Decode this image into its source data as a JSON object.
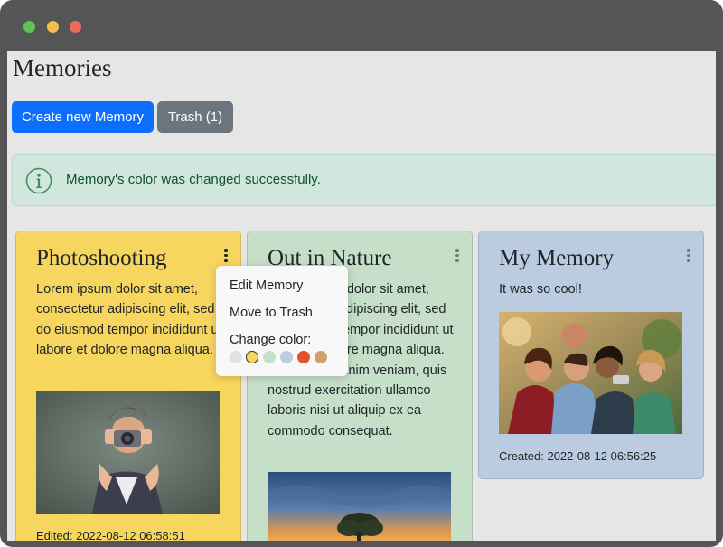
{
  "window": {
    "controls": [
      {
        "name": "minimize",
        "color": "#5ec454"
      },
      {
        "name": "maximize",
        "color": "#f4bf4f"
      },
      {
        "name": "close",
        "color": "#ee6a5f"
      }
    ]
  },
  "page": {
    "title": "Memories",
    "buttons": {
      "create_label": "Create new Memory",
      "trash_label": "Trash (1)"
    },
    "alert": {
      "icon": "info-circle-icon",
      "text": "Memory's color was changed successfully."
    }
  },
  "cards": [
    {
      "title": "Photoshooting",
      "color": "#f7d65f",
      "text": "Lorem ipsum dolor sit amet, consectetur adipiscing elit, sed do eiusmod tempor incididunt ut labore et dolore magna aliqua.",
      "image": "boy-with-camera-photo",
      "footer": "Edited: 2022-08-12 06:58:51"
    },
    {
      "title": "Out in Nature",
      "color": "#c5dfc8",
      "text": "Lorem ipsum dolor sit amet, consectetur adipiscing elit, sed do eiusmod tempor incididunt ut labore et dolore magna aliqua. Ut enim ad minim veniam, quis nostrud exercitation ullamco laboris nisi ut aliquip ex ea commodo consequat.",
      "image": "sunset-tree-photo"
    },
    {
      "title": "My Memory",
      "color": "#bccce0",
      "text": "It was so cool!",
      "image": "friends-selfie-photo",
      "footer": "Created: 2022-08-12 06:56:25"
    }
  ],
  "context_menu": {
    "edit_label": "Edit Memory",
    "trash_label": "Move to Trash",
    "change_color_label": "Change color:",
    "colors": [
      "#e0e0e0",
      "#f7d65f",
      "#c5dfc8",
      "#bccce0",
      "#e2532d",
      "#d2a06a"
    ],
    "selected_color": "#f7d65f"
  }
}
